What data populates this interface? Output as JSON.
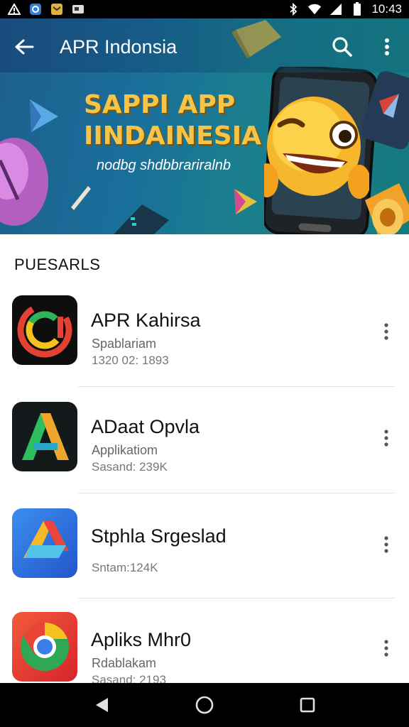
{
  "status_bar": {
    "time": "10:43",
    "left_icons": [
      "warning-icon",
      "notification-icon",
      "mail-icon",
      "image-icon"
    ],
    "right_icons": [
      "bluetooth-icon",
      "wifi-icon",
      "signal-icon",
      "battery-icon"
    ]
  },
  "app_bar": {
    "title": "APR Indonsia",
    "back_icon": "back-arrow-icon",
    "search_icon": "search-icon",
    "more_icon": "more-vert-icon"
  },
  "banner": {
    "headline_line1": "SAPPI APP",
    "headline_line2": "IINDAINESIA",
    "subtitle": "nodbg shdbbrariralnb",
    "colors": {
      "headline": "#f7c448",
      "background": "#1a6f9a"
    }
  },
  "section": {
    "title": "PUESARLS"
  },
  "apps": [
    {
      "name": "APR Kahirsa",
      "line2": "Spablariam",
      "line3": "1320 02: 1893",
      "icon": "app-icon-c"
    },
    {
      "name": "ADaat Opvla",
      "line2": "Applikatiom",
      "line3": "Sasand: 239K",
      "icon": "app-icon-a"
    },
    {
      "name": "Stphla Srgeslad",
      "line2": "",
      "line3": "Sntam:124K",
      "icon": "app-icon-arrow"
    },
    {
      "name": "Apliks Mhr0",
      "line2": "Rdablakam",
      "line3": "Sasand: 2193",
      "icon": "app-icon-chrome"
    }
  ],
  "nav_bar": {
    "back_icon": "nav-back-icon",
    "home_icon": "nav-home-icon",
    "recents_icon": "nav-recents-icon"
  }
}
